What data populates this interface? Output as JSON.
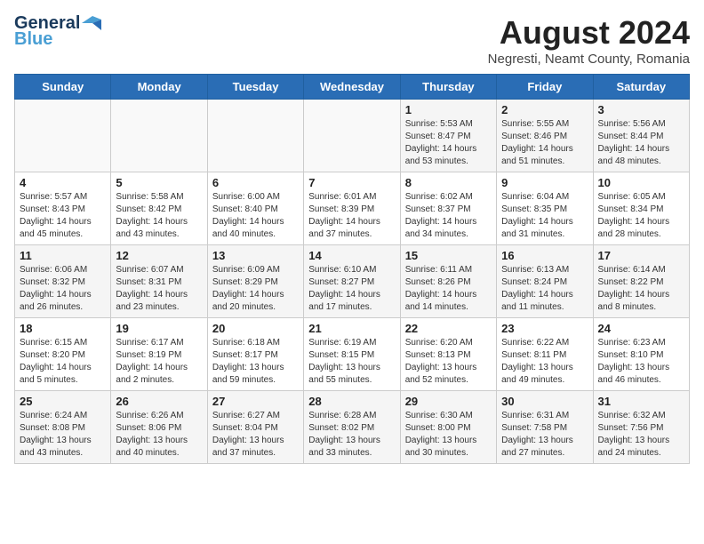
{
  "header": {
    "logo_line1": "General",
    "logo_line2": "Blue",
    "month_year": "August 2024",
    "location": "Negresti, Neamt County, Romania"
  },
  "days_of_week": [
    "Sunday",
    "Monday",
    "Tuesday",
    "Wednesday",
    "Thursday",
    "Friday",
    "Saturday"
  ],
  "weeks": [
    [
      {
        "day": "",
        "info": ""
      },
      {
        "day": "",
        "info": ""
      },
      {
        "day": "",
        "info": ""
      },
      {
        "day": "",
        "info": ""
      },
      {
        "day": "1",
        "info": "Sunrise: 5:53 AM\nSunset: 8:47 PM\nDaylight: 14 hours\nand 53 minutes."
      },
      {
        "day": "2",
        "info": "Sunrise: 5:55 AM\nSunset: 8:46 PM\nDaylight: 14 hours\nand 51 minutes."
      },
      {
        "day": "3",
        "info": "Sunrise: 5:56 AM\nSunset: 8:44 PM\nDaylight: 14 hours\nand 48 minutes."
      }
    ],
    [
      {
        "day": "4",
        "info": "Sunrise: 5:57 AM\nSunset: 8:43 PM\nDaylight: 14 hours\nand 45 minutes."
      },
      {
        "day": "5",
        "info": "Sunrise: 5:58 AM\nSunset: 8:42 PM\nDaylight: 14 hours\nand 43 minutes."
      },
      {
        "day": "6",
        "info": "Sunrise: 6:00 AM\nSunset: 8:40 PM\nDaylight: 14 hours\nand 40 minutes."
      },
      {
        "day": "7",
        "info": "Sunrise: 6:01 AM\nSunset: 8:39 PM\nDaylight: 14 hours\nand 37 minutes."
      },
      {
        "day": "8",
        "info": "Sunrise: 6:02 AM\nSunset: 8:37 PM\nDaylight: 14 hours\nand 34 minutes."
      },
      {
        "day": "9",
        "info": "Sunrise: 6:04 AM\nSunset: 8:35 PM\nDaylight: 14 hours\nand 31 minutes."
      },
      {
        "day": "10",
        "info": "Sunrise: 6:05 AM\nSunset: 8:34 PM\nDaylight: 14 hours\nand 28 minutes."
      }
    ],
    [
      {
        "day": "11",
        "info": "Sunrise: 6:06 AM\nSunset: 8:32 PM\nDaylight: 14 hours\nand 26 minutes."
      },
      {
        "day": "12",
        "info": "Sunrise: 6:07 AM\nSunset: 8:31 PM\nDaylight: 14 hours\nand 23 minutes."
      },
      {
        "day": "13",
        "info": "Sunrise: 6:09 AM\nSunset: 8:29 PM\nDaylight: 14 hours\nand 20 minutes."
      },
      {
        "day": "14",
        "info": "Sunrise: 6:10 AM\nSunset: 8:27 PM\nDaylight: 14 hours\nand 17 minutes."
      },
      {
        "day": "15",
        "info": "Sunrise: 6:11 AM\nSunset: 8:26 PM\nDaylight: 14 hours\nand 14 minutes."
      },
      {
        "day": "16",
        "info": "Sunrise: 6:13 AM\nSunset: 8:24 PM\nDaylight: 14 hours\nand 11 minutes."
      },
      {
        "day": "17",
        "info": "Sunrise: 6:14 AM\nSunset: 8:22 PM\nDaylight: 14 hours\nand 8 minutes."
      }
    ],
    [
      {
        "day": "18",
        "info": "Sunrise: 6:15 AM\nSunset: 8:20 PM\nDaylight: 14 hours\nand 5 minutes."
      },
      {
        "day": "19",
        "info": "Sunrise: 6:17 AM\nSunset: 8:19 PM\nDaylight: 14 hours\nand 2 minutes."
      },
      {
        "day": "20",
        "info": "Sunrise: 6:18 AM\nSunset: 8:17 PM\nDaylight: 13 hours\nand 59 minutes."
      },
      {
        "day": "21",
        "info": "Sunrise: 6:19 AM\nSunset: 8:15 PM\nDaylight: 13 hours\nand 55 minutes."
      },
      {
        "day": "22",
        "info": "Sunrise: 6:20 AM\nSunset: 8:13 PM\nDaylight: 13 hours\nand 52 minutes."
      },
      {
        "day": "23",
        "info": "Sunrise: 6:22 AM\nSunset: 8:11 PM\nDaylight: 13 hours\nand 49 minutes."
      },
      {
        "day": "24",
        "info": "Sunrise: 6:23 AM\nSunset: 8:10 PM\nDaylight: 13 hours\nand 46 minutes."
      }
    ],
    [
      {
        "day": "25",
        "info": "Sunrise: 6:24 AM\nSunset: 8:08 PM\nDaylight: 13 hours\nand 43 minutes."
      },
      {
        "day": "26",
        "info": "Sunrise: 6:26 AM\nSunset: 8:06 PM\nDaylight: 13 hours\nand 40 minutes."
      },
      {
        "day": "27",
        "info": "Sunrise: 6:27 AM\nSunset: 8:04 PM\nDaylight: 13 hours\nand 37 minutes."
      },
      {
        "day": "28",
        "info": "Sunrise: 6:28 AM\nSunset: 8:02 PM\nDaylight: 13 hours\nand 33 minutes."
      },
      {
        "day": "29",
        "info": "Sunrise: 6:30 AM\nSunset: 8:00 PM\nDaylight: 13 hours\nand 30 minutes."
      },
      {
        "day": "30",
        "info": "Sunrise: 6:31 AM\nSunset: 7:58 PM\nDaylight: 13 hours\nand 27 minutes."
      },
      {
        "day": "31",
        "info": "Sunrise: 6:32 AM\nSunset: 7:56 PM\nDaylight: 13 hours\nand 24 minutes."
      }
    ]
  ]
}
